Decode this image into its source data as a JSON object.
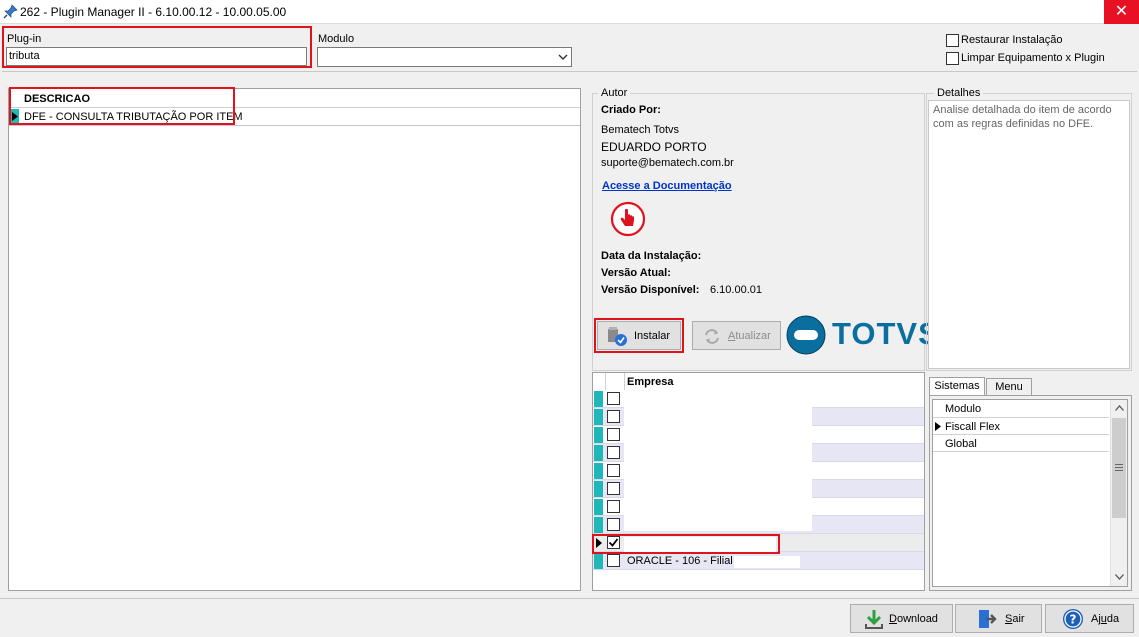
{
  "window": {
    "title": "262 - Plugin Manager II - 6.10.00.12 - 10.00.05.00",
    "close_glyph": "✕"
  },
  "filters": {
    "plugin_label": "Plug-in",
    "plugin_value": "tributa",
    "modulo_label": "Modulo",
    "modulo_value": "",
    "restaurar_label": "Restaurar Instalação",
    "limpar_label": "Limpar Equipamento x Plugin"
  },
  "plugins_grid": {
    "header": "DESCRICAO",
    "rows": [
      {
        "descricao": "DFE - CONSULTA TRIBUTAÇÃO POR ITEM",
        "selected": true
      }
    ]
  },
  "autor": {
    "group_label": "Autor",
    "criado_por_label": "Criado Por:",
    "company": "Bematech Totvs",
    "author": "EDUARDO PORTO",
    "email": "suporte@bematech.com.br",
    "doc_link": "Acesse a Documentação",
    "data_instalacao_label": "Data da Instalação:",
    "data_instalacao_value": "",
    "versao_atual_label": "Versão Atual:",
    "versao_atual_value": "",
    "versao_disponivel_label": "Versão Disponível:",
    "versao_disponivel_value": "6.10.00.01",
    "instalar_label": "Instalar",
    "atualizar_label": "Atualizar",
    "brand": "TOTVS"
  },
  "detalhes": {
    "group_label": "Detalhes",
    "text": "Analise detalhada do item de acordo com as regras definidas no DFE."
  },
  "empresa_grid": {
    "header": "Empresa",
    "rows": [
      {
        "checked": false,
        "name": ""
      },
      {
        "checked": false,
        "name": ""
      },
      {
        "checked": false,
        "name": ""
      },
      {
        "checked": false,
        "name": ""
      },
      {
        "checked": false,
        "name": ""
      },
      {
        "checked": false,
        "name": ""
      },
      {
        "checked": false,
        "name": ""
      },
      {
        "checked": false,
        "name": ""
      },
      {
        "checked": true,
        "name": ""
      },
      {
        "checked": false,
        "name": "ORACLE - 106 - Filial"
      }
    ]
  },
  "sistemas": {
    "tabs": [
      {
        "label": "Sistemas",
        "active": true
      },
      {
        "label": "Menu",
        "active": false
      }
    ],
    "header": "Modulo",
    "rows": [
      {
        "label": "Fiscall Flex",
        "current": true
      },
      {
        "label": "Global",
        "current": false
      }
    ]
  },
  "footer": {
    "download_label": "Download",
    "sair_label": "Sair",
    "ajuda_label": "Ajuda"
  },
  "colors": {
    "highlight_red": "#e0121b",
    "row_indicator_teal": "#1fb7b7",
    "totvs_blue": "#0a6e9e",
    "link_blue": "#0033cc",
    "close_red": "#e81123"
  }
}
